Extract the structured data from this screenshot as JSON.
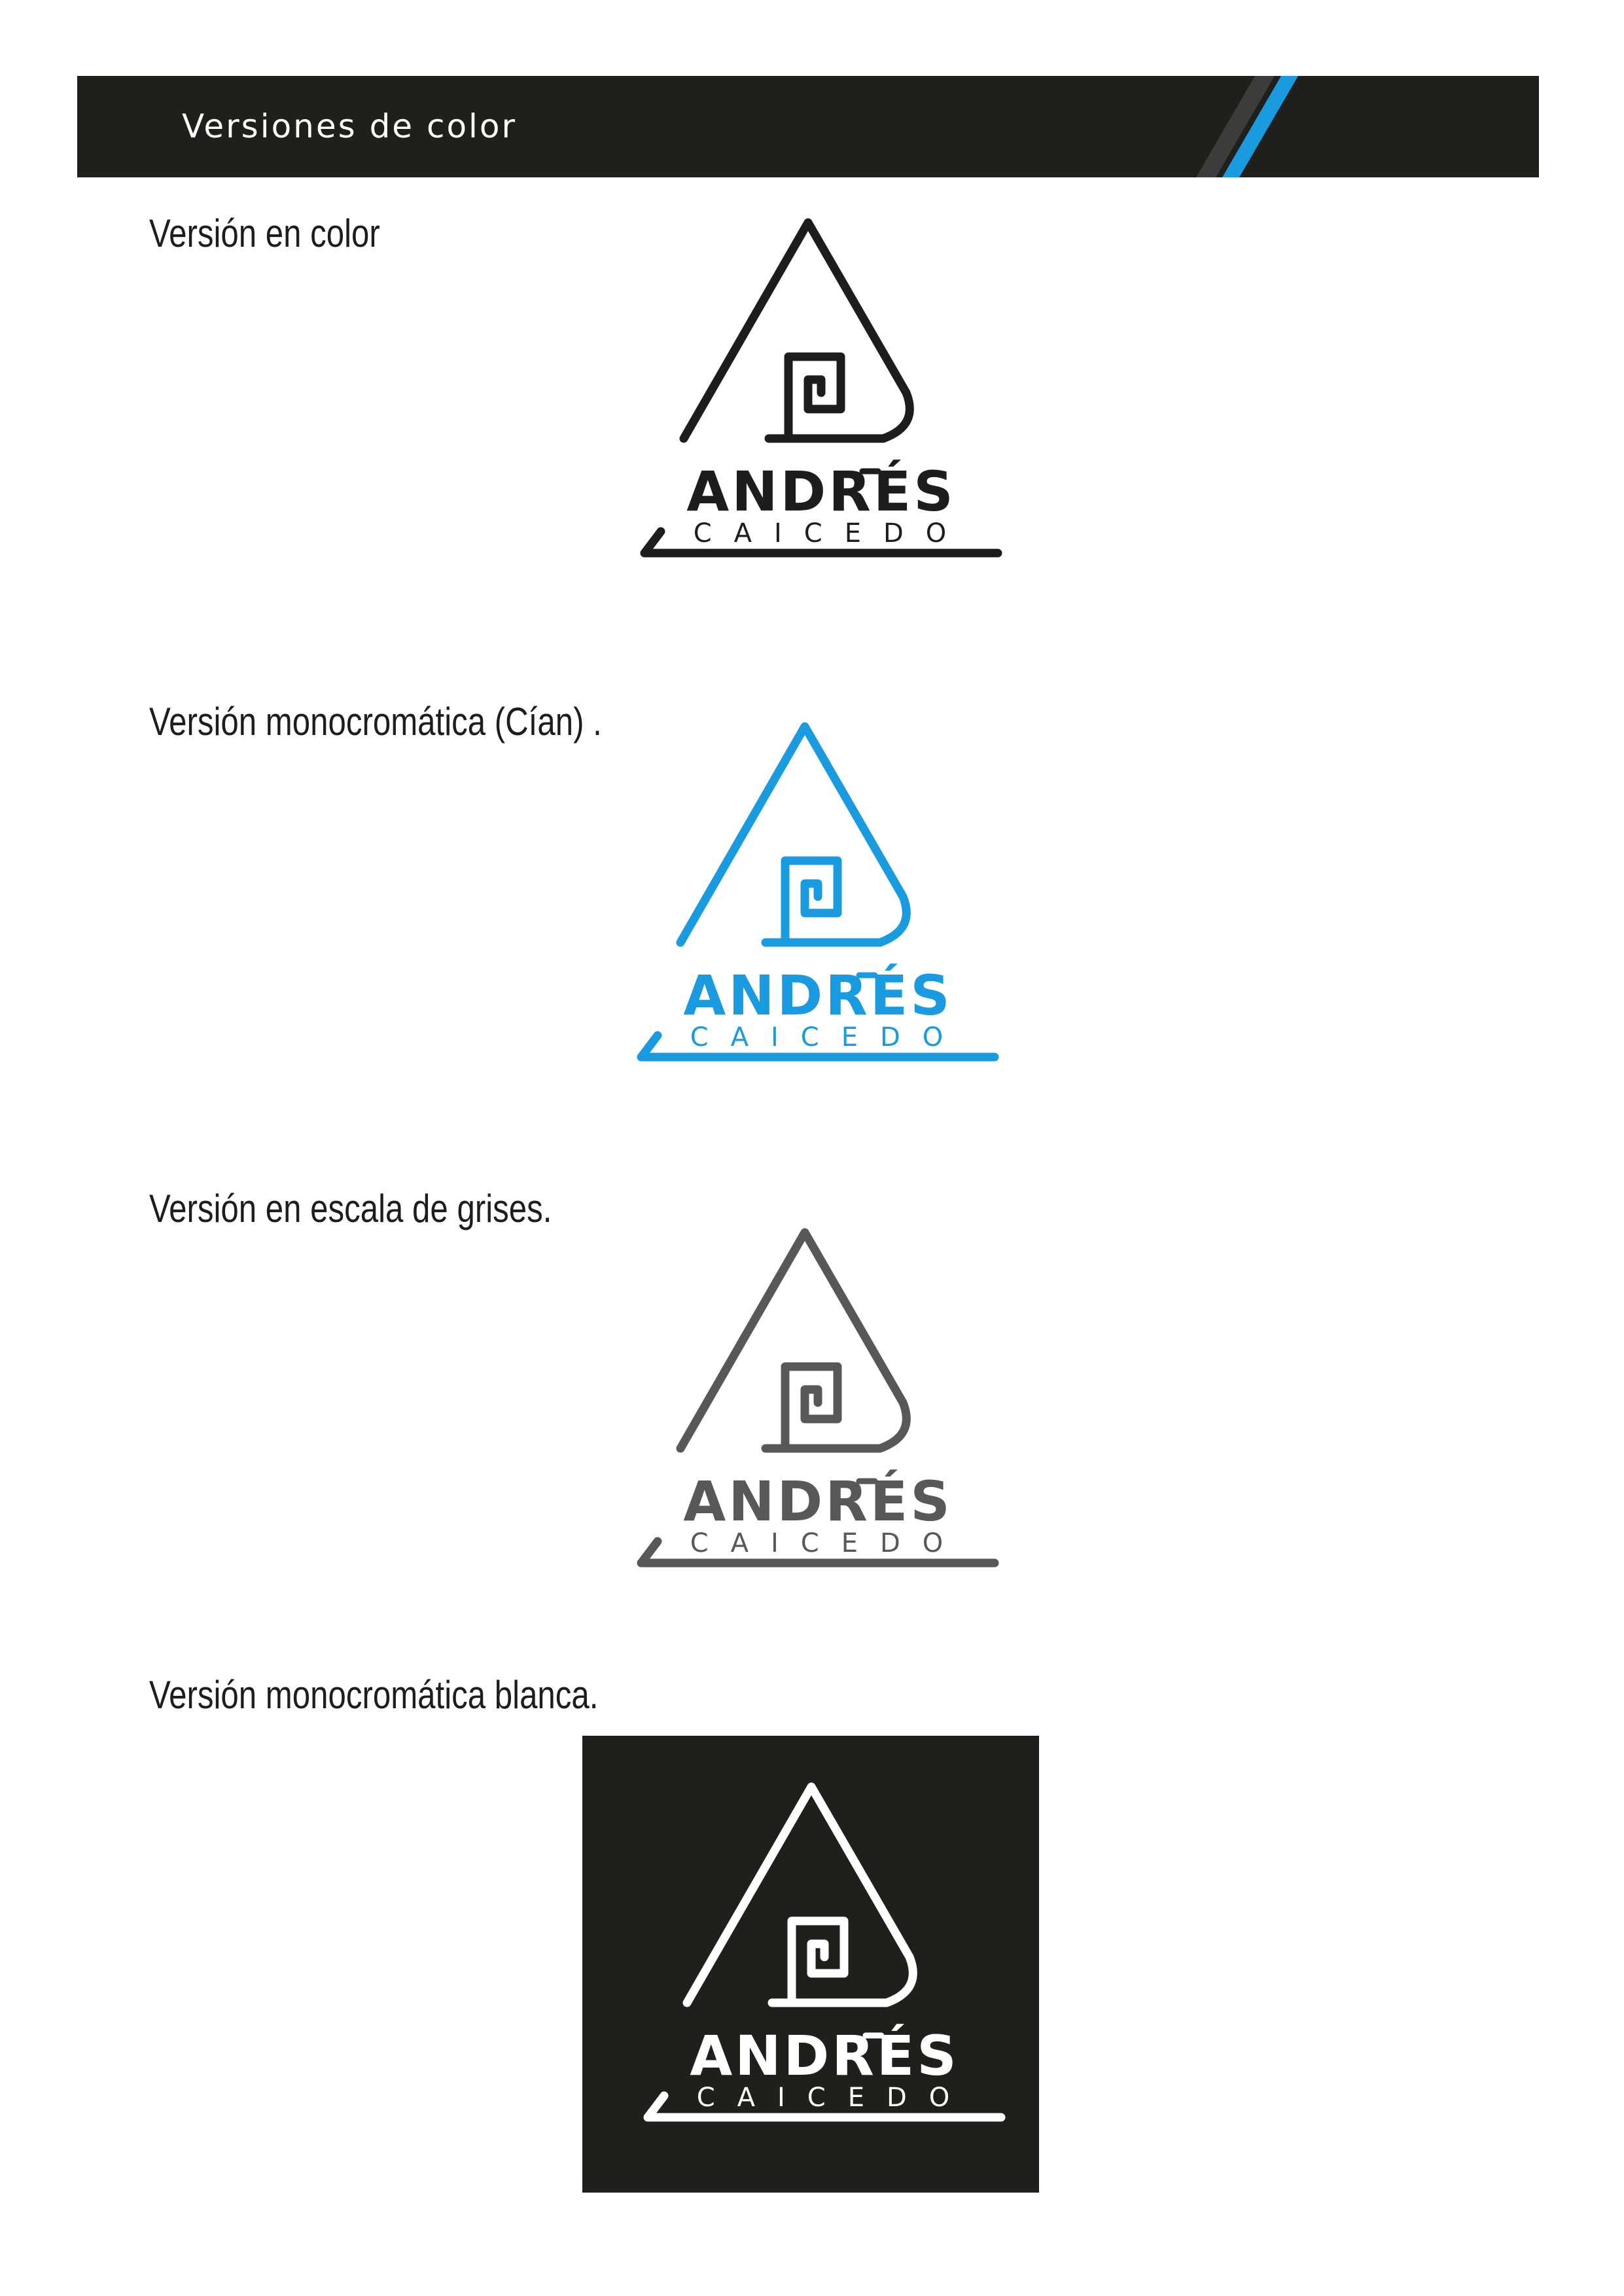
{
  "header": {
    "title": "Versiones de color",
    "accent_color": "#1a9be0",
    "bar_color": "#1f1f1b"
  },
  "sections": [
    {
      "label": "Versión en color",
      "logo_color": "#1d1d1b",
      "background": "#ffffff"
    },
    {
      "label": "Versión monocromática (Cían) .",
      "logo_color": "#1a9be0",
      "background": "#ffffff"
    },
    {
      "label": "Versión en escala de grises.",
      "logo_color": "#58585a",
      "background": "#ffffff"
    },
    {
      "label": "Versión monocromática blanca.",
      "logo_color": "#ffffff",
      "background": "#1f1f1b"
    }
  ],
  "logo": {
    "name": "ANDRÉS",
    "surname": "CAICEDO"
  }
}
